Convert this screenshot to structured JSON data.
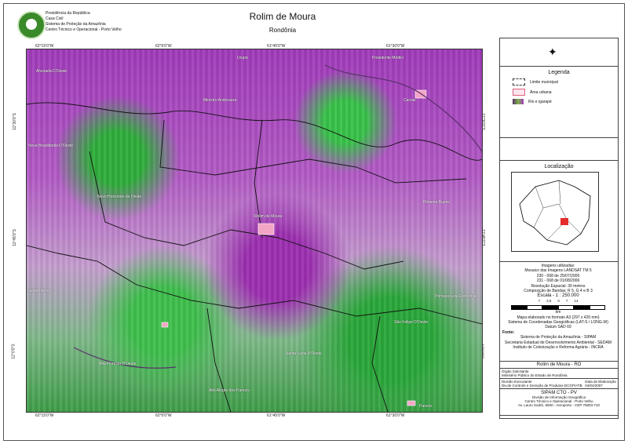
{
  "header": {
    "lines": [
      "Presidência da República",
      "Casa Civil",
      "Sistema de Proteção da Amazônia",
      "Centro Técnico e Operacional - Porto Velho"
    ],
    "title": "Rolim de Moura",
    "subtitle": "Rondônia"
  },
  "map": {
    "top_ticks": [
      "62°15'0\"W",
      "62°0'0\"W",
      "61°45'0\"W",
      "61°30'0\"W"
    ],
    "bottom_ticks": [
      "62°15'0\"W",
      "62°0'0\"W",
      "61°45'0\"W",
      "61°30'0\"W"
    ],
    "left_ticks": [
      "11°30'0\"S",
      "11°45'0\"S",
      "12°0'0\"S"
    ],
    "right_ticks": [
      "11°30'0\"S",
      "11°45'0\"S",
      "12°0'0\"S"
    ],
    "places": [
      "Alvorada D'Oeste",
      "Nova Brasilândia D'Oeste",
      "Novo Horizonte do Oeste",
      "Rolim de Moura",
      "Santa Luzia D'Oeste",
      "Alta Floresta D'Oeste",
      "Alto Alegre dos Parecis",
      "São Felipe D'Oeste",
      "Parecis",
      "Primavera de Rondônia",
      "Pimenta Bueno",
      "Cacoal",
      "Castanheiras",
      "Ministro Andreazza",
      "Urupá",
      "Presidente Médici"
    ]
  },
  "legend": {
    "title": "Legenda",
    "items": [
      {
        "label": "Limite municipal",
        "color": "#ffffff"
      },
      {
        "label": "Área urbana",
        "color": "#f7b6c8"
      },
      {
        "label": "Rio e igarapé",
        "color": "#5a2f6b"
      }
    ]
  },
  "location": {
    "title": "Localização",
    "top_ticks": [
      "66°0'0\"W",
      "64°0'0\"W",
      "62°0'0\"W",
      "60°0'0\"W"
    ],
    "bottom_ticks": [
      "66°0'0\"W",
      "64°0'0\"W",
      "62°0'0\"W",
      "60°0'0\"W"
    ],
    "left_ticks": [
      "8°0'0\"S",
      "10°0'0\"S",
      "12°0'0\"S"
    ],
    "right_ticks": [
      "8°0'0\"S",
      "10°0'0\"S",
      "12°0'0\"S"
    ]
  },
  "notes": {
    "images_title": "Imagens utilizadas:",
    "mosaic": "Mosaico das Imagens LANDSAT TM 5",
    "scene1": "230 - 068 de 25/07/2006",
    "scene2": "231 - 068 de 01/08/2006",
    "resolution": "Resolução Espacial: 30 metros",
    "composition": "Composição de Bandas: R 5, G 4 e B 3",
    "scale_title": "Escala - 1 : 250.000",
    "scale_labels": [
      "7",
      "3,5",
      "0",
      "7",
      "14"
    ],
    "scale_unit": "km",
    "scale_note": "Mapa elaborado no formato A3 (297 x 420 mm)",
    "coord_system": "Sistema de Coordenadas Geográficas (LAT-S / LONG-W)",
    "datum": "Datum SAD 69",
    "source_label": "Fonte:",
    "sources": [
      "Sistema de Proteção da Amazônia - SIPAM",
      "Secretaria Estadual de Desenvolvimento Ambiental - SEDAM",
      "Instituto de Colonização e Reforma Agrária - INCRA"
    ]
  },
  "info": {
    "map_title": "Rolim de Moura - RO",
    "requester_label": "Órgão Solicitante",
    "requester": "Ministério Público do Estado de Rondônia",
    "executor_label": "Divisão Executante",
    "executor": "Div.de Controle e Geração de Produtos-DCGP/ATB",
    "date_label": "Data de Elaboração",
    "date": "04/04/2007",
    "logo_text": "SIPAM CTO - PV",
    "logo_sub": "Divisão de Informação Geográfica",
    "address": [
      "Centro Técnico e Operacional - Porto Velho",
      "Av. Lauro Sodré, 6500 - Aeroporto - CEP 76803-710"
    ]
  }
}
